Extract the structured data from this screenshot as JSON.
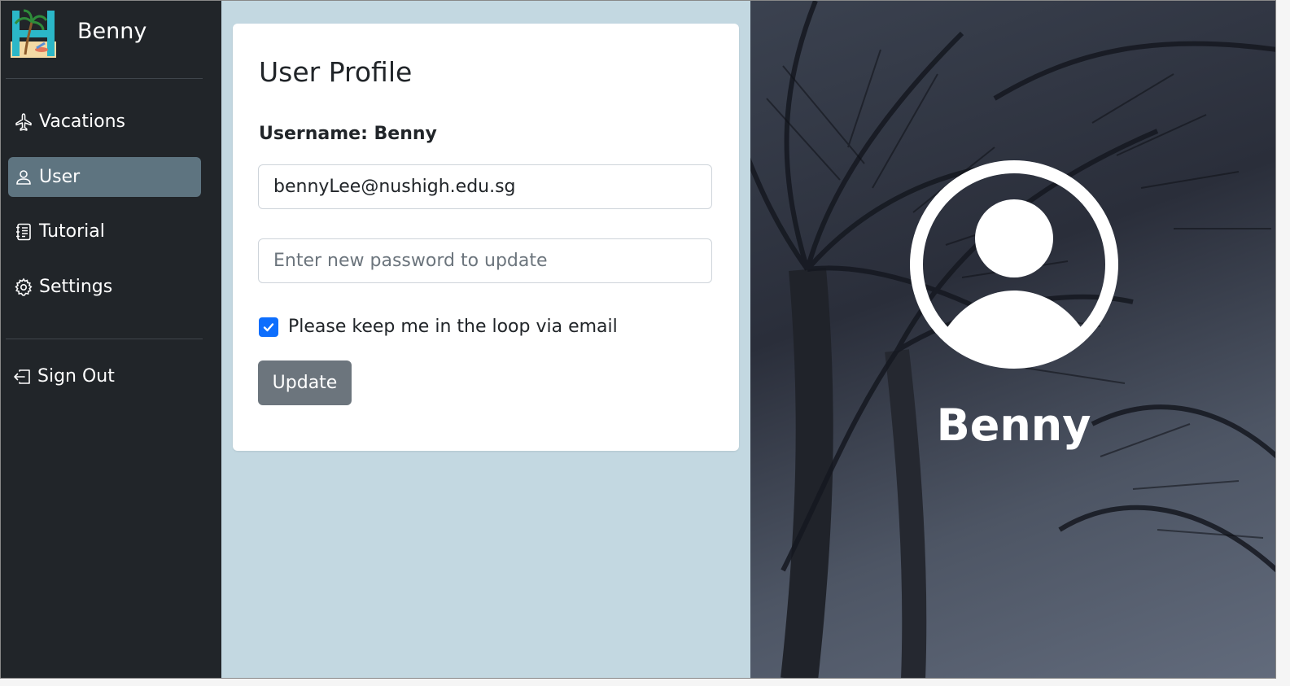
{
  "app": {
    "brand_name": "Benny"
  },
  "sidebar": {
    "items": [
      {
        "label": "Vacations",
        "icon": "airplane-icon",
        "active": false
      },
      {
        "label": "User",
        "icon": "person-icon",
        "active": true
      },
      {
        "label": "Tutorial",
        "icon": "journal-icon",
        "active": false
      },
      {
        "label": "Settings",
        "icon": "gear-icon",
        "active": false
      }
    ],
    "signout": {
      "label": "Sign Out",
      "icon": "box-arrow-left-icon"
    }
  },
  "profile": {
    "title": "User Profile",
    "username_label": "Username: Benny",
    "email_value": "bennyLee@nushigh.edu.sg",
    "password_placeholder": "Enter new password to update",
    "newsletter_label": "Please keep me in the loop via email",
    "newsletter_checked": true,
    "update_label": "Update"
  },
  "hero": {
    "name": "Benny",
    "avatar_icon": "person-circle-icon"
  },
  "colors": {
    "sidebar_bg": "#212529",
    "active_item": "#5e7480",
    "panel_bg": "#c3d8e1",
    "checkbox": "#0d6efd",
    "button": "#6c757d"
  }
}
